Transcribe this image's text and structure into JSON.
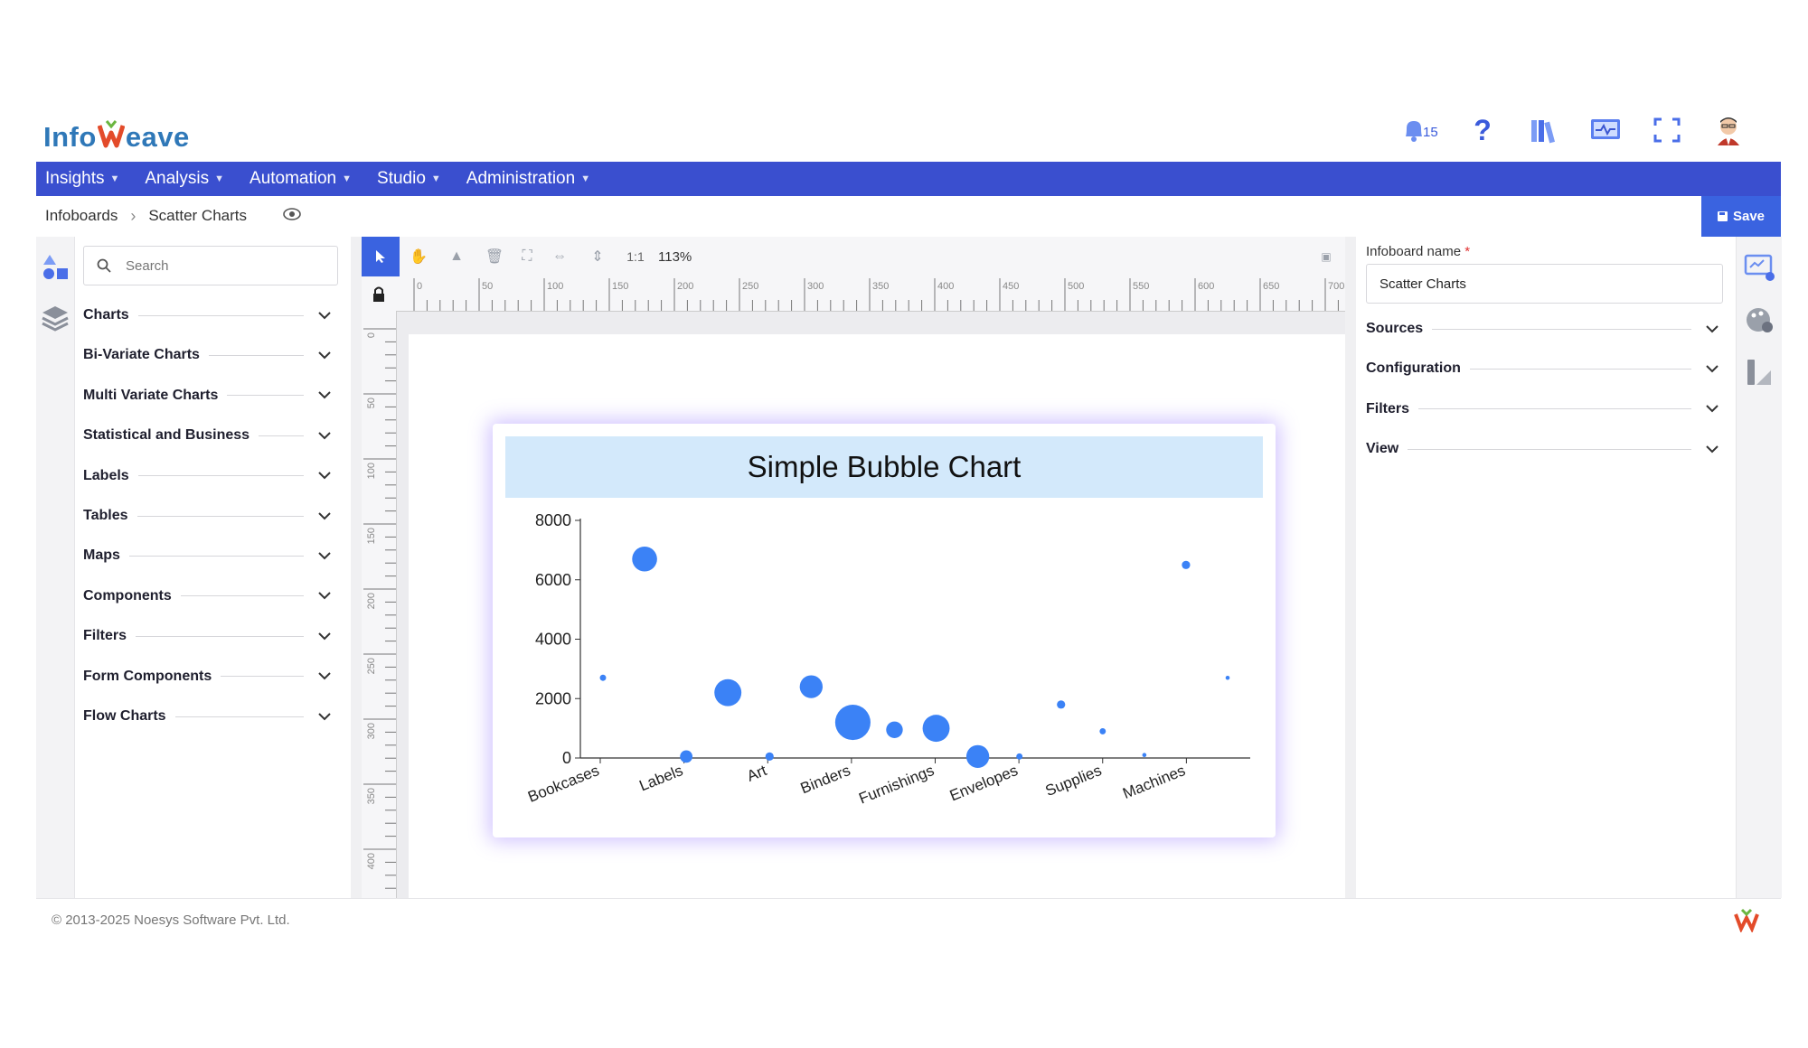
{
  "app": {
    "logo_text_a": "Info",
    "logo_text_b": "eave",
    "notification_count": "15"
  },
  "header_icons": [
    "bell-icon",
    "help-icon",
    "library-icon",
    "monitor-icon",
    "fullscreen-icon",
    "avatar"
  ],
  "nav": {
    "items": [
      "Insights",
      "Analysis",
      "Automation",
      "Studio",
      "Administration"
    ]
  },
  "breadcrumb": {
    "root": "Infoboards",
    "current": "Scatter Charts"
  },
  "toolbar": {
    "save_label": "Save",
    "scale_label": "1:1",
    "zoom": "113%"
  },
  "left_panel": {
    "search_placeholder": "Search",
    "categories": [
      "Charts",
      "Bi-Variate Charts",
      "Multi Variate Charts",
      "Statistical and Business",
      "Labels",
      "Tables",
      "Maps",
      "Components",
      "Filters",
      "Form Components",
      "Flow Charts"
    ]
  },
  "ruler": {
    "h_labels": [
      "0",
      "50",
      "100",
      "150",
      "200",
      "250",
      "300",
      "350",
      "400",
      "450",
      "500",
      "550",
      "600",
      "650",
      "700"
    ],
    "v_labels": [
      "0",
      "50",
      "100",
      "150",
      "200",
      "250",
      "300",
      "350",
      "400"
    ]
  },
  "right_panel": {
    "name_label": "Infoboard name",
    "required_mark": "*",
    "name_value": "Scatter Charts",
    "sections": [
      "Sources",
      "Configuration",
      "Filters",
      "View"
    ]
  },
  "footer": {
    "copyright": "© 2013-2025 Noesys Software Pvt. Ltd."
  },
  "colors": {
    "nav": "#3a4fcf",
    "accent": "#3a63e0",
    "bubble": "#3b82f6",
    "title_band": "#d3e9fb"
  },
  "chart_data": {
    "type": "scatter",
    "title": "Simple Bubble Chart",
    "categories": [
      "Bookcases",
      "Labels",
      "Art",
      "Binders",
      "Furnishings",
      "Envelopes",
      "Supplies",
      "Machines"
    ],
    "y_ticks": [
      0,
      2000,
      4000,
      6000,
      8000
    ],
    "ylim": [
      0,
      8000
    ],
    "points": [
      {
        "x": 0.0,
        "y": 2700,
        "r": 3
      },
      {
        "x": 1.0,
        "y": 6700,
        "r": 12
      },
      {
        "x": 2.0,
        "y": 50,
        "r": 6
      },
      {
        "x": 3.0,
        "y": 2200,
        "r": 13
      },
      {
        "x": 4.0,
        "y": 50,
        "r": 4
      },
      {
        "x": 5.0,
        "y": 2400,
        "r": 11
      },
      {
        "x": 6.0,
        "y": 1200,
        "r": 17
      },
      {
        "x": 7.0,
        "y": 950,
        "r": 8
      },
      {
        "x": 8.0,
        "y": 1000,
        "r": 13
      },
      {
        "x": 9.0,
        "y": 50,
        "r": 11
      },
      {
        "x": 10.0,
        "y": 50,
        "r": 3
      },
      {
        "x": 11.0,
        "y": 1800,
        "r": 4
      },
      {
        "x": 12.0,
        "y": 900,
        "r": 3
      },
      {
        "x": 13.0,
        "y": 100,
        "r": 2
      },
      {
        "x": 14.0,
        "y": 6500,
        "r": 4
      },
      {
        "x": 15.0,
        "y": 2700,
        "r": 2
      }
    ]
  }
}
